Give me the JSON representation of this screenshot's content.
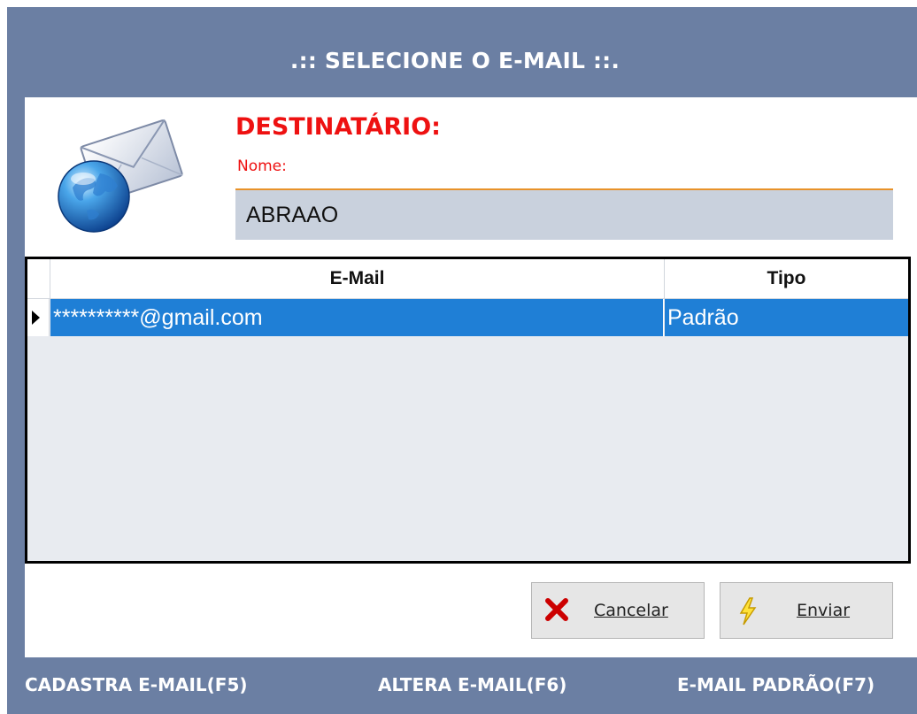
{
  "window": {
    "title": ".:: SELECIONE O E-MAIL ::."
  },
  "recipient": {
    "heading": "DESTINATÁRIO:",
    "name_label": "Nome:",
    "name_value": "ABRAAO"
  },
  "grid": {
    "columns": [
      "E-Mail",
      "Tipo"
    ],
    "rows": [
      {
        "email": "**********@gmail.com",
        "tipo": "Padrão",
        "selected": true
      }
    ],
    "selection_color": "#1f7fd6"
  },
  "buttons": {
    "cancel_label": "Cancelar",
    "send_label": "Enviar",
    "cancel_icon": "close-icon",
    "send_icon": "lightning-icon"
  },
  "footer": {
    "register_email": "CADASTRA E-MAIL(F5)",
    "edit_email": "ALTERA E-MAIL(F6)",
    "default_email": "E-MAIL PADRÃO(F7)"
  },
  "colors": {
    "frame": "#6b7fa3",
    "accent_red": "#ee1111",
    "field_bg": "#c9d1dd",
    "field_border": "#e8922a"
  }
}
